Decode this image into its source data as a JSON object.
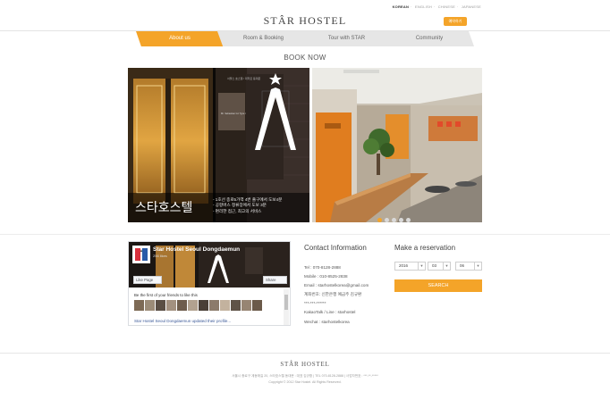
{
  "header": {
    "languages": [
      "KOREAN",
      "ENGLISH",
      "CHINESE",
      "JAPANESE"
    ],
    "logo": "STÂR HOSTEL",
    "reserve_button": "예약하기"
  },
  "nav": {
    "items": [
      "About us",
      "Room & Booking",
      "Tour with STAR",
      "Community"
    ]
  },
  "main": {
    "book_now": "BOOK NOW"
  },
  "slider": {
    "caption_title": "스타호스텔",
    "caption_lines": [
      "- 1호선 종로5가역 4번 출구에서 도보4분",
      "- 공항버스 정류장에서 도보 3분",
      "- 편리한 접근, 최고의 서비스"
    ],
    "door_sign": "서울스 호스텔 / 대학로 동대문",
    "door_sign_en": "Mr. Sebastian Inc Type / Sungkin Apart",
    "dot_count": 5,
    "active_dot": 0
  },
  "facebook": {
    "page_name": "Star Hostel Seoul Dongdaemun",
    "likes": "256 likes",
    "like_label": "Like Page",
    "share_label": "Share",
    "friends_text": "Be the first of your friends to like this",
    "post_text": "Star Hostel Seoul Dongdaemun updated their profile..."
  },
  "contact": {
    "title": "Contact Information",
    "lines": [
      "Tel : 070-8128-2888",
      "Mobile : 010-8525-2838",
      "Email : starhostelkorea@gmail.com",
      "계좌번호: 신한은행 예금주 김규환",
      "***-***-******",
      "KakaoTalk / Line : starhostel",
      "Wechat : starhostelkorea"
    ]
  },
  "reservation": {
    "title": "Make a reservation",
    "year": "2016",
    "month": "03",
    "day": "06",
    "search_label": "SEARCH"
  },
  "footer": {
    "logo": "STÂR HOSTEL",
    "address": "서울시 종로구 계동에길 20, 스타호스텔 동대문 : 대표 김규환 | TEL 070-8128-2888 | 사업자번호 : ***-**-*****",
    "copyright": "Copyright © 2012 Star Hostel. All Rights Reserved."
  },
  "colors": {
    "accent": "#f4a429",
    "nav_inactive": "#e6e6e6",
    "text": "#555555"
  }
}
